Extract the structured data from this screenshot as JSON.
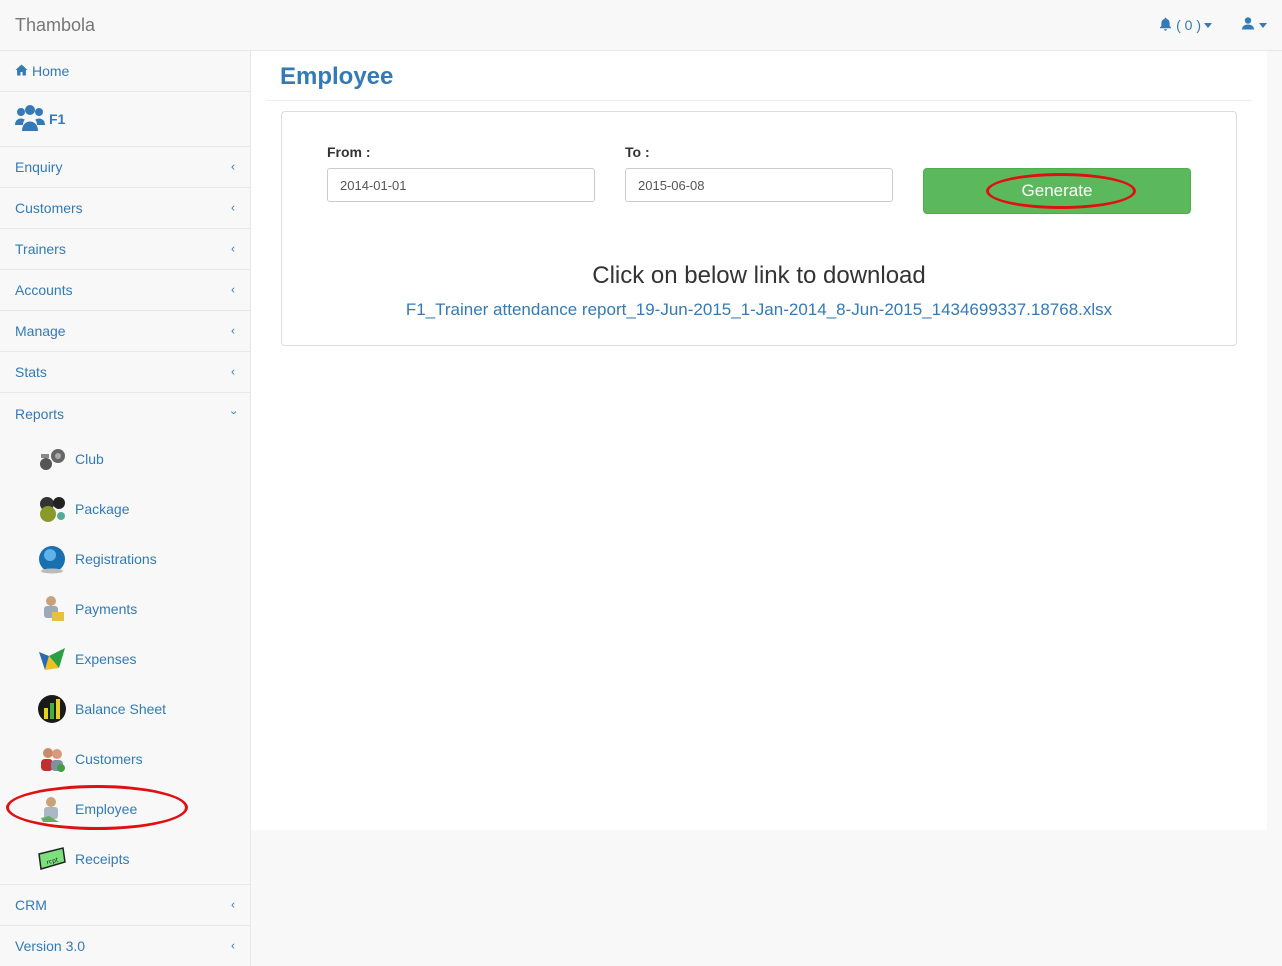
{
  "app": {
    "brand": "Thambola"
  },
  "header": {
    "notif_count": "( 0 )",
    "bell_icon": "bell-icon",
    "user_icon": "user-icon"
  },
  "sidebar": {
    "home": "Home",
    "profile_name": "F1",
    "menu": [
      {
        "label": "Enquiry"
      },
      {
        "label": "Customers"
      },
      {
        "label": "Trainers"
      },
      {
        "label": "Accounts"
      },
      {
        "label": "Manage"
      },
      {
        "label": "Stats"
      }
    ],
    "reports": {
      "label": "Reports",
      "items": [
        {
          "label": "Club",
          "icon": "club-icon"
        },
        {
          "label": "Package",
          "icon": "package-icon"
        },
        {
          "label": "Registrations",
          "icon": "registrations-icon"
        },
        {
          "label": "Payments",
          "icon": "payments-icon"
        },
        {
          "label": "Expenses",
          "icon": "expenses-icon"
        },
        {
          "label": "Balance Sheet",
          "icon": "balance-sheet-icon"
        },
        {
          "label": "Customers",
          "icon": "customers-icon"
        },
        {
          "label": "Employee",
          "icon": "employee-icon"
        },
        {
          "label": "Receipts",
          "icon": "receipts-icon"
        }
      ]
    },
    "bottom": [
      {
        "label": "CRM"
      },
      {
        "label": "Version 3.0"
      }
    ]
  },
  "main": {
    "title": "Employee",
    "from_label": "From :",
    "from_value": "2014-01-01",
    "to_label": "To :",
    "to_value": "2015-06-08",
    "generate_label": "Generate",
    "download_prompt": "Click on below link to download",
    "download_link": "F1_Trainer attendance report_19-Jun-2015_1-Jan-2014_8-Jun-2015_1434699337.18768.xlsx"
  },
  "colors": {
    "accent": "#337ab7",
    "success": "#5cb85c",
    "highlight": "#e01010"
  }
}
